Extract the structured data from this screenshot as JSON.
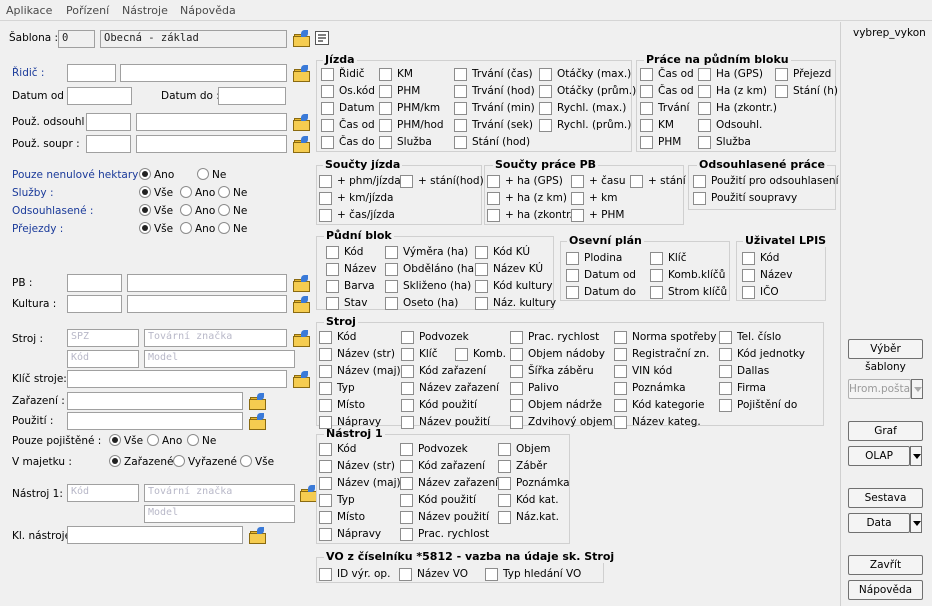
{
  "menu": [
    "Aplikace",
    "Pořízení",
    "Nástroje",
    "Nápověda"
  ],
  "template": {
    "label": "Šablona :",
    "id": "0",
    "name": "Obecná - základ"
  },
  "right_panel": {
    "title": "vybrep_vykon",
    "buttons": {
      "select_template": "Výběr šablony",
      "bulk_mail": "Hrom.pošta",
      "graph": "Graf",
      "olap": "OLAP",
      "report": "Sestava",
      "data": "Data",
      "close": "Zavřít",
      "help": "Nápověda"
    }
  },
  "form": {
    "driver": "Řidič :",
    "date_from": "Datum od :",
    "date_to": "Datum do :",
    "used_remover": "Použ. odsouhl :",
    "used_sets": "Použ. soupr :",
    "pb": "PB :",
    "culture": "Kultura :",
    "machine": "Stroj :",
    "machine_key": "Klíč stroje:",
    "assignment": "Zařazení :",
    "usage": "Použití :",
    "tool": "Nástroj 1:",
    "tool_key": "Kl. nástroje:",
    "ph_spz": "SPZ",
    "ph_brand": "Tovární značka",
    "ph_code": "Kód",
    "ph_model": "Model"
  },
  "filters": {
    "nonzero": {
      "label": "Pouze nenulové hektary :",
      "options": [
        "Ano",
        "Ne"
      ]
    },
    "services": {
      "label": "Služby :",
      "options": [
        "Vše",
        "Ano",
        "Ne"
      ]
    },
    "approved": {
      "label": "Odsouhlasené :",
      "options": [
        "Vše",
        "Ano",
        "Ne"
      ]
    },
    "crossings": {
      "label": "Přejezdy :",
      "options": [
        "Vše",
        "Ano",
        "Ne"
      ]
    },
    "insured": {
      "label": "Pouze pojištěné :",
      "options": [
        "Vše",
        "Ano",
        "Ne"
      ]
    },
    "owned": {
      "label": "V majetku :",
      "options": [
        "Zařazené",
        "Vyřazené",
        "Vše"
      ]
    }
  },
  "groups": {
    "jizda": {
      "title": "Jízda",
      "items": [
        "Řidič",
        "KM",
        "Trvání (čas)",
        "Otáčky (max.)",
        "Os.kód",
        "PHM",
        "Trvání (hod)",
        "Otáčky (prům.)",
        "Datum",
        "PHM/km",
        "Trvání (min)",
        "Rychl. (max.)",
        "Čas od",
        "PHM/hod",
        "Trvání (sek)",
        "Rychl. (prům.)",
        "Čas do",
        "Služba",
        "Stání (hod)"
      ]
    },
    "prace": {
      "title": "Práce na půdním bloku",
      "items": [
        "Čas od",
        "Ha (GPS)",
        "Přejezd",
        "Čas od",
        "Ha (z km)",
        "Stání (h)",
        "Trvání",
        "Ha (zkontr.)",
        "KM",
        "Odsouhl.",
        "PHM",
        "Služba"
      ]
    },
    "soucty_jizda": {
      "title": "Součty jízda",
      "items": [
        "+ phm/jízda",
        "+ stání(hod)",
        "+ km/jízda",
        "+ čas/jízda"
      ]
    },
    "soucty_pb": {
      "title": "Součty práce PB",
      "items": [
        "+ ha (GPS)",
        "+ času",
        "+ stání",
        "+ ha (z km)",
        "+ km",
        "+ ha (zkontr.)",
        "+ PHM"
      ]
    },
    "odsouhlasene": {
      "title": "Odsouhlasené práce",
      "items": [
        "Použití pro odsouhlasení",
        "Použití soupravy"
      ]
    },
    "pudni_blok": {
      "title": "Půdní blok",
      "items": [
        "Kód",
        "Výměra (ha)",
        "Kód KÚ",
        "Název",
        "Obděláno (ha)",
        "Název KÚ",
        "Barva",
        "Skliženo (ha)",
        "Kód kultury",
        "Stav",
        "Oseto (ha)",
        "Náz. kultury"
      ]
    },
    "osevni": {
      "title": "Osevní plán",
      "items": [
        "Plodina",
        "Klíč",
        "Datum od",
        "Komb.klíčů",
        "Datum do",
        "Strom klíčů"
      ]
    },
    "lpis": {
      "title": "Uživatel LPIS",
      "items": [
        "Kód",
        "Název",
        "IČO"
      ]
    },
    "stroj": {
      "title": "Stroj",
      "items": [
        "Kód",
        "Podvozek",
        "Prac. rychlost",
        "Norma spotřeby",
        "Tel. číslo",
        "Název (str)",
        "Klíč",
        "Komb.",
        "Objem nádoby",
        "Registrační zn.",
        "Kód jednotky",
        "Název (maj)",
        "Kód zařazení",
        "Šířka záběru",
        "VIN kód",
        "Dallas",
        "Typ",
        "Název zařazení",
        "Palivo",
        "Poznámka",
        "Firma",
        "Místo",
        "Kód použití",
        "Objem nádrže",
        "Kód kategorie",
        "Pojištění do",
        "Nápravy",
        "Název použití",
        "Zdvihový objem",
        "Název kateg."
      ]
    },
    "nastroj": {
      "title": "Nástroj 1",
      "items": [
        "Kód",
        "Podvozek",
        "Objem",
        "Název (str)",
        "Kód zařazení",
        "Záběr",
        "Název (maj)",
        "Název zařazení",
        "Poznámka",
        "Typ",
        "Kód použití",
        "Kód kat.",
        "Místo",
        "Název použití",
        "Náz.kat.",
        "Nápravy",
        "Prac. rychlost"
      ]
    },
    "vo": {
      "title": "VO z číselníku *5812 - vazba na údaje sk. Stroj",
      "items": [
        "ID výr. op.",
        "Název VO",
        "Typ hledání VO"
      ]
    }
  }
}
